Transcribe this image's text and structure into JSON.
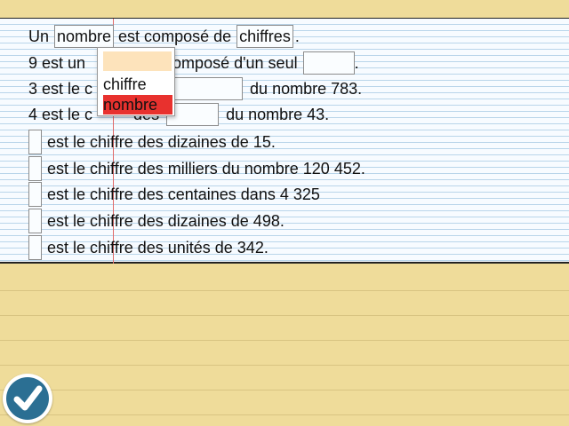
{
  "exercise": {
    "line1": {
      "text_a": "Un",
      "box_a": "nombre",
      "text_b": "est composé de",
      "box_b": "chiffres",
      "text_c": "."
    },
    "line2": {
      "text_a": "9 est un",
      "text_b": "composé d'un seul",
      "text_c": "."
    },
    "line3": {
      "text_a": "3 est le c",
      "text_b": "s",
      "text_c": "du nombre 783."
    },
    "line4": {
      "text_a": "4 est le c",
      "text_b": "des",
      "text_c": "du nombre 43."
    },
    "statements": [
      "est le chiffre des dizaines de 15.",
      "est le chiffre des milliers du nombre 120 452.",
      "est le chiffre des centaines dans 4 325",
      "est le chiffre des dizaines de 498.",
      "est le chiffre des unités de 342."
    ]
  },
  "dropdown": {
    "options": [
      "chiffre",
      "nombre"
    ],
    "highlighted": "nombre"
  },
  "check_button": {
    "icon": "checkmark-icon",
    "color": "#2b6f93"
  },
  "colors": {
    "paper": "#f7fbff",
    "paper_lines": "#b9d5ea",
    "margin_line": "#e06a6a",
    "background": "#efdc9a",
    "highlight": "#e8312e",
    "dropdown_selected": "#fde3bb"
  }
}
